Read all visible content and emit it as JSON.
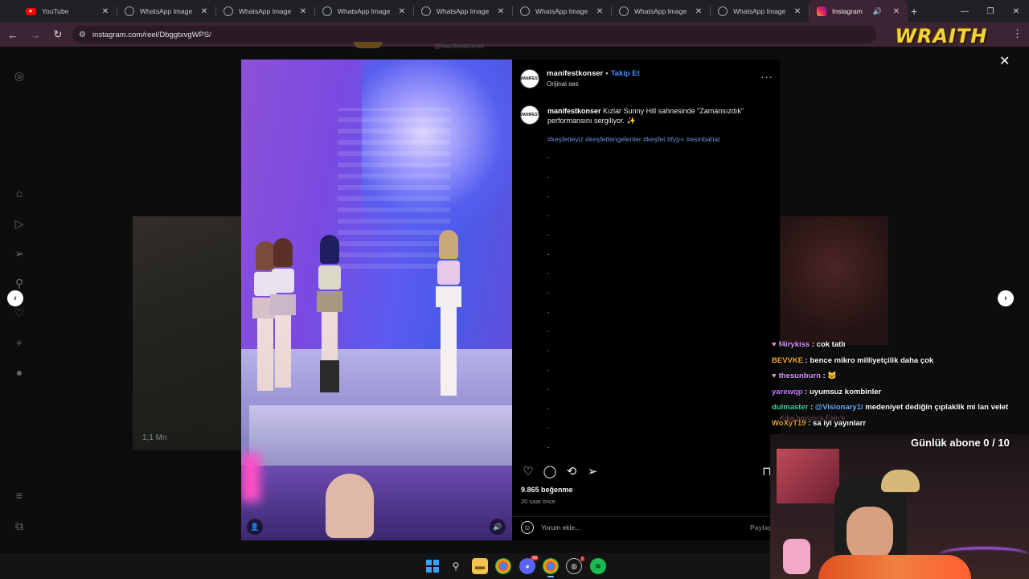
{
  "browser": {
    "tabs": [
      {
        "label": "YouTube",
        "icon": "youtube-icon"
      },
      {
        "label": "WhatsApp Image 2024",
        "icon": "globe-icon"
      },
      {
        "label": "WhatsApp Image 2024",
        "icon": "globe-icon"
      },
      {
        "label": "WhatsApp Image 2024",
        "icon": "globe-icon"
      },
      {
        "label": "WhatsApp Image 2024",
        "icon": "globe-icon"
      },
      {
        "label": "WhatsApp Image 2024",
        "icon": "globe-icon"
      },
      {
        "label": "WhatsApp Image 2024",
        "icon": "globe-icon"
      },
      {
        "label": "WhatsApp Image 2024",
        "icon": "globe-icon"
      },
      {
        "label": "Instagram",
        "icon": "instagram-icon",
        "active": true
      }
    ],
    "url": "instagram.com/reel/DbggtxvgWPS/"
  },
  "overlay": {
    "logo_text": "WRAITH",
    "sub_goal": "Günlük abone 0 / 10",
    "ghost_text": "Kıka boyunca Esin'e"
  },
  "post": {
    "username": "manifestkonser",
    "follow_label": "Takip Et",
    "audio_label": "Orijinal ses",
    "avatar_text": "MANIFEST",
    "caption": "Kızlar Sunny Hill sahnesinde \"Zamansızdık\" performansını sergiliyor. ✨",
    "hashtags": "#keşfetteyiz #keşfettengelenler #keşfet #fyp⟡ #esinbahat",
    "dots": [
      ".",
      ".",
      ".",
      ".",
      ".",
      ".",
      ".",
      ".",
      ".",
      ".",
      ".",
      ".",
      ".",
      ".",
      ".",
      ".",
      "."
    ],
    "likes": "9.865 beğenme",
    "time": "20 saat önce",
    "comment_placeholder": "Yorum ekle...",
    "share_label": "Paylaş"
  },
  "background": {
    "prev_views": "1,1 Mn",
    "top_user": "@manifestkonser"
  },
  "chat": [
    {
      "user": "f4irykiss",
      "text": "cok tatlı",
      "color": "#d89aff",
      "heart": true
    },
    {
      "user": "BEVVKE",
      "text": "bence mikro milliyetçilik daha çok",
      "color": "#f2a838",
      "heart": false
    },
    {
      "user": "thesunburn",
      "text": "🐱",
      "color": "#d89aff",
      "heart": true
    },
    {
      "user": "yarewqp",
      "text": "uyumsuz kombinler",
      "color": "#c57cff",
      "heart": false
    },
    {
      "user": "dulmaster",
      "text": "medeniyet dediğin çıplaklik mi lan velet",
      "mention": "@Visionary1i",
      "color": "#3dd4a0",
      "heart": false
    },
    {
      "user": "WoXyT19",
      "text": "sa iyi yayınlarr",
      "color": "#e0a030",
      "heart": false
    }
  ],
  "colors": {
    "accent_follow": "#4a8cff",
    "tab_active_bg": "#3c2435"
  }
}
